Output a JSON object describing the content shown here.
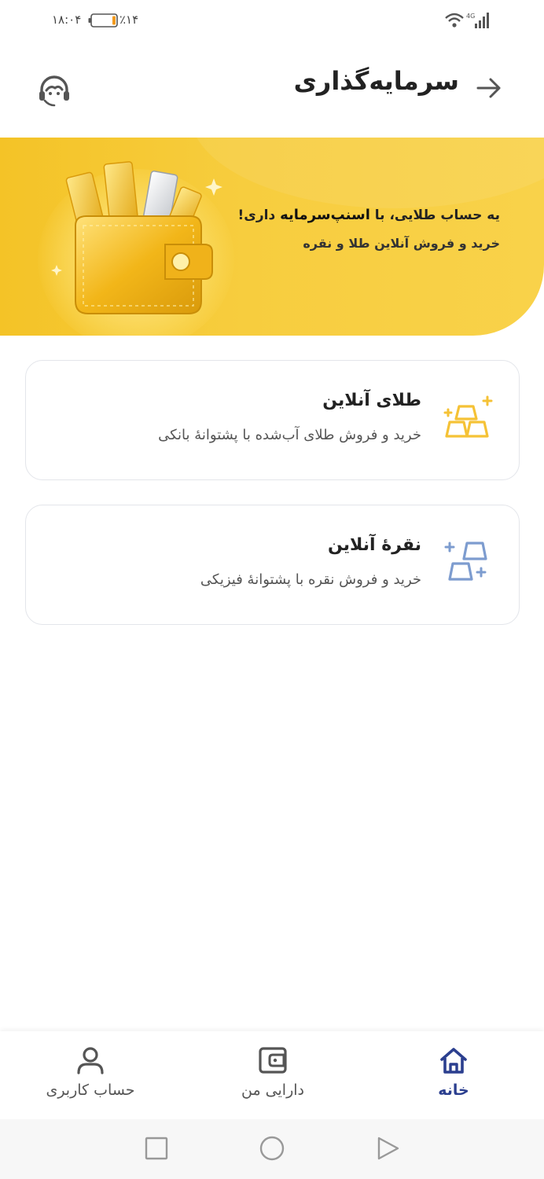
{
  "status_bar": {
    "time": "۱۸:۰۴",
    "battery_percent": "٪۱۴",
    "battery_level": 0.14,
    "network": "4G"
  },
  "header": {
    "title": "سرمایه‌گذاری",
    "back_icon": "arrow-right-icon",
    "support_icon": "headset-support-icon"
  },
  "banner": {
    "line1_prefix": "یه حساب طلایی، با ",
    "line1_brand": "اسنپ‌سرمایه",
    "line1_suffix": " داری!",
    "line2": "خرید و فروش آنلاین طلا و نقره"
  },
  "cards": [
    {
      "title": "طلای آنلاین",
      "subtitle": "خرید و فروش طلای آب‌شده با پشتوانهٔ بانکی",
      "icon": "gold-bars-icon",
      "accent": "#f5c236"
    },
    {
      "title": "نقرهٔ آنلاین",
      "subtitle": "خرید و فروش نقره با پشتوانهٔ فیزیکی",
      "icon": "silver-bars-icon",
      "accent": "#7d9ccf"
    }
  ],
  "bottom_nav": {
    "items": [
      {
        "label": "خانه",
        "icon": "home-icon",
        "active": true
      },
      {
        "label": "دارایی من",
        "icon": "wallet-icon",
        "active": false
      },
      {
        "label": "حساب کاربری",
        "icon": "user-icon",
        "active": false
      }
    ]
  },
  "colors": {
    "primary": "#2b3f8f",
    "banner": "#f6c93a",
    "gold": "#f5c236",
    "silver": "#7d9ccf"
  }
}
